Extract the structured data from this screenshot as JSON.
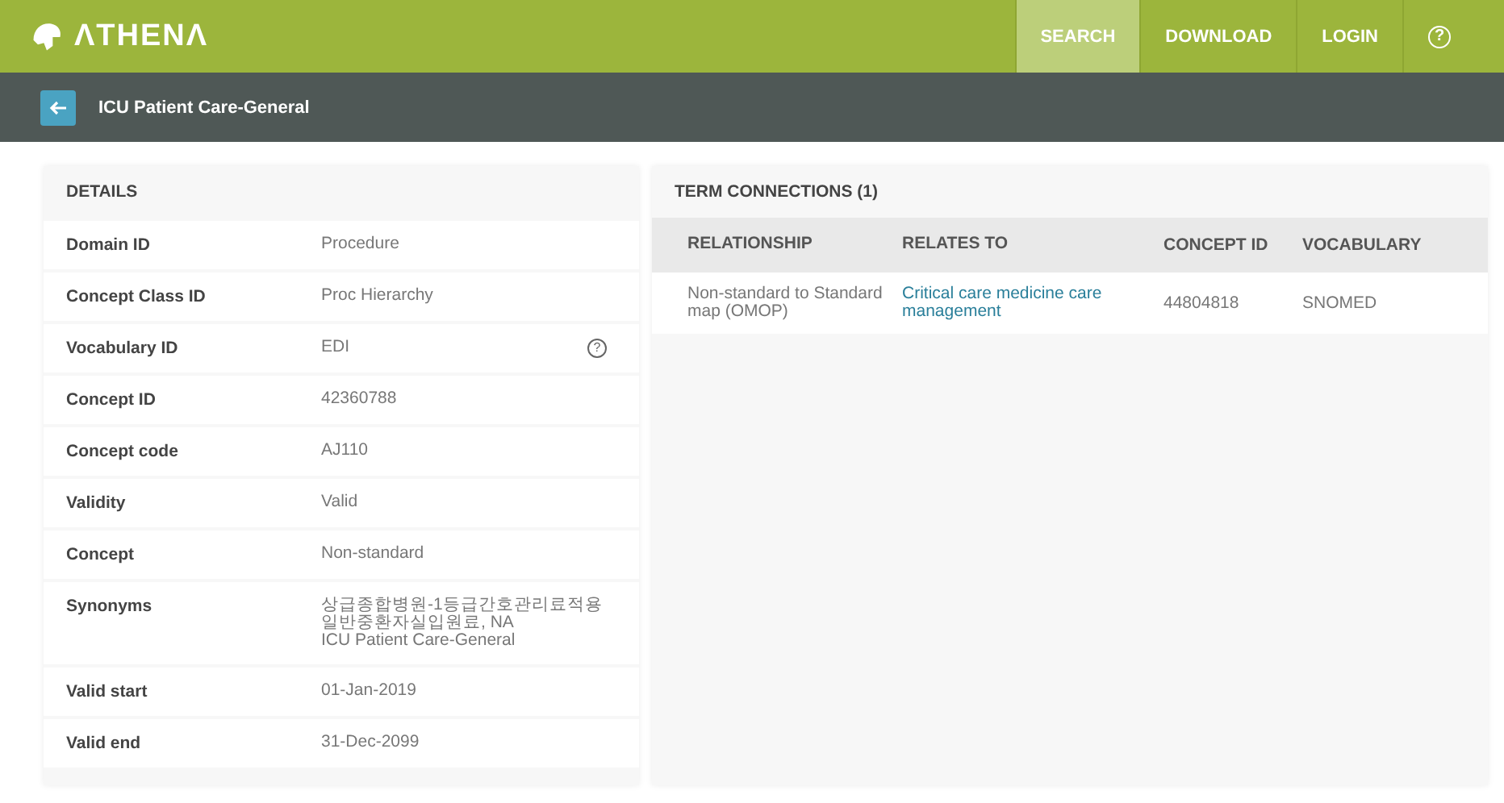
{
  "brand": "ΛTHENΛ",
  "nav": [
    {
      "label": "SEARCH",
      "kind": "text",
      "selected": true
    },
    {
      "label": "DOWNLOAD",
      "kind": "text",
      "selected": false
    },
    {
      "label": "LOGIN",
      "kind": "text",
      "selected": false
    },
    {
      "label": "?",
      "kind": "help",
      "selected": false
    }
  ],
  "page_title": "ICU Patient Care-General",
  "details": {
    "title": "DETAILS",
    "rows": [
      {
        "label": "Domain ID",
        "lines": [
          "Procedure"
        ]
      },
      {
        "label": "Concept Class ID",
        "lines": [
          "Proc Hierarchy"
        ]
      },
      {
        "label": "Vocabulary ID",
        "lines": [
          "EDI"
        ],
        "help": "?"
      },
      {
        "label": "Concept ID",
        "lines": [
          "42360788"
        ]
      },
      {
        "label": "Concept code",
        "lines": [
          "AJ110"
        ]
      },
      {
        "label": "Validity",
        "lines": [
          "Valid"
        ]
      },
      {
        "label": "Concept",
        "lines": [
          "Non-standard"
        ]
      },
      {
        "label": "Synonyms",
        "lines": [
          "상급종합병원-1등급간호관리료적용",
          "일반중환자실입원료, NA",
          "ICU Patient Care-General"
        ]
      },
      {
        "label": "Valid start",
        "lines": [
          "01-Jan-2019"
        ]
      },
      {
        "label": "Valid end",
        "lines": [
          "31-Dec-2099"
        ]
      }
    ]
  },
  "connections": {
    "title": "TERM CONNECTIONS (1)",
    "columns": [
      "RELATIONSHIP",
      "RELATES TO",
      "CONCEPT ID",
      "VOCABULARY"
    ],
    "rows": [
      {
        "relationship": "Non-standard to Standard map (OMOP)",
        "relates_to": "Critical care medicine care management",
        "concept_id": "44804818",
        "vocabulary": "SNOMED"
      }
    ]
  }
}
